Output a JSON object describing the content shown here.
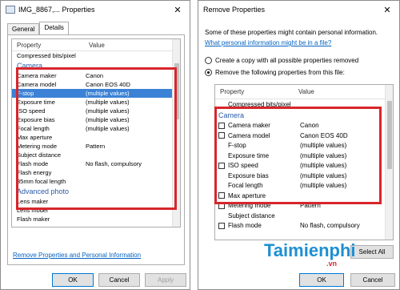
{
  "left_dialog": {
    "title": "IMG_8867,... Properties",
    "tabs": [
      {
        "label": "General"
      },
      {
        "label": "Details"
      }
    ],
    "columns": {
      "property": "Property",
      "value": "Value"
    },
    "rows": [
      {
        "property": "Compressed bits/pixel",
        "value": ""
      },
      {
        "property": "Camera",
        "value": "",
        "group": true
      },
      {
        "property": "Camera maker",
        "value": "Canon"
      },
      {
        "property": "Camera model",
        "value": "Canon EOS 40D"
      },
      {
        "property": "F-stop",
        "value": "(multiple values)",
        "selected": true
      },
      {
        "property": "Exposure time",
        "value": "(multiple values)"
      },
      {
        "property": "ISO speed",
        "value": "(multiple values)"
      },
      {
        "property": "Exposure bias",
        "value": "(multiple values)"
      },
      {
        "property": "Focal length",
        "value": "(multiple values)"
      },
      {
        "property": "Max aperture",
        "value": ""
      },
      {
        "property": "Metering mode",
        "value": "Pattern"
      },
      {
        "property": "Subject distance",
        "value": ""
      },
      {
        "property": "Flash mode",
        "value": "No flash, compulsory"
      },
      {
        "property": "Flash energy",
        "value": ""
      },
      {
        "property": "35mm focal length",
        "value": ""
      },
      {
        "property": "Advanced photo",
        "value": "",
        "group": true
      },
      {
        "property": "Lens maker",
        "value": ""
      },
      {
        "property": "Lens model",
        "value": ""
      },
      {
        "property": "Flash maker",
        "value": ""
      }
    ],
    "remove_link": "Remove Properties and Personal Information",
    "buttons": {
      "ok": "OK",
      "cancel": "Cancel",
      "apply": "Apply"
    }
  },
  "right_dialog": {
    "title": "Remove Properties",
    "intro": "Some of these properties might contain personal information.",
    "help_link": "What personal information might be in a file?",
    "options": [
      {
        "label": "Create a copy with all possible properties removed",
        "checked": false
      },
      {
        "label": "Remove the following properties from this file:",
        "checked": true
      }
    ],
    "columns": {
      "property": "Property",
      "value": "Value"
    },
    "rows": [
      {
        "property": "Compressed bits/pixel",
        "value": "",
        "checkbox": false
      },
      {
        "property": "Camera",
        "value": "",
        "group": true
      },
      {
        "property": "Camera maker",
        "value": "Canon",
        "checkbox": true
      },
      {
        "property": "Camera model",
        "value": "Canon EOS 40D",
        "checkbox": true
      },
      {
        "property": "F-stop",
        "value": "(multiple values)",
        "checkbox": false
      },
      {
        "property": "Exposure time",
        "value": "(multiple values)",
        "checkbox": false
      },
      {
        "property": "ISO speed",
        "value": "(multiple values)",
        "checkbox": true
      },
      {
        "property": "Exposure bias",
        "value": "(multiple values)",
        "checkbox": false
      },
      {
        "property": "Focal length",
        "value": "(multiple values)",
        "checkbox": false
      },
      {
        "property": "Max aperture",
        "value": "",
        "checkbox": true
      },
      {
        "property": "Metering mode",
        "value": "Pattern",
        "checkbox": true
      },
      {
        "property": "Subject distance",
        "value": "",
        "checkbox": false
      },
      {
        "property": "Flash mode",
        "value": "No flash, compulsory",
        "checkbox": true
      }
    ],
    "select_all": "Select All",
    "buttons": {
      "ok": "OK",
      "cancel": "Cancel"
    }
  },
  "watermark": {
    "brand": "Taimienphi",
    "suffix": ".vn"
  },
  "colors": {
    "highlight": "#d7262c",
    "selection": "#3b82d6",
    "link": "#0563c1"
  }
}
